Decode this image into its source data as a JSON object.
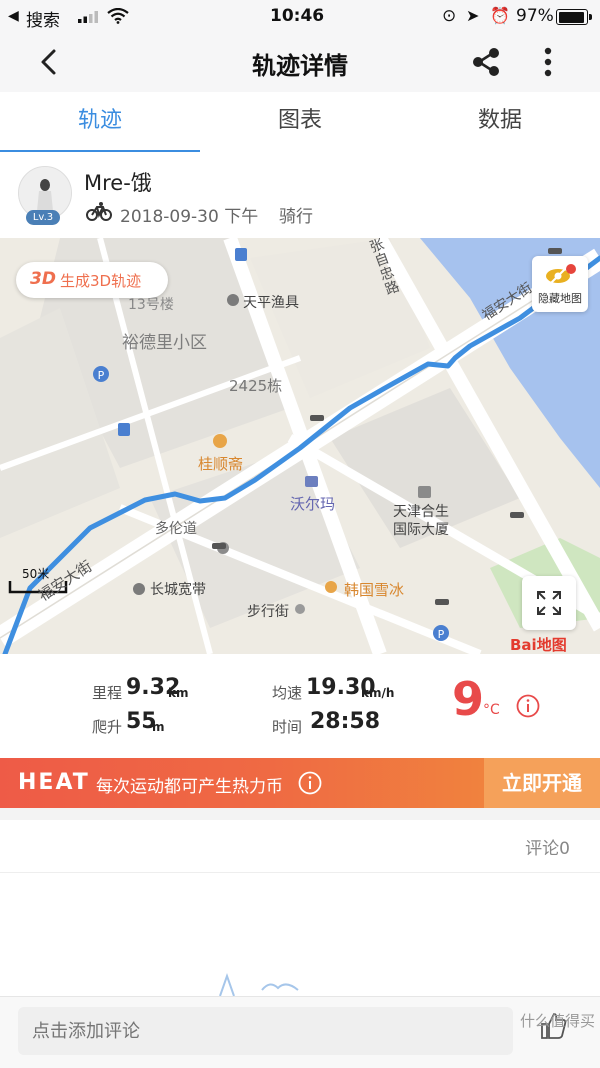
{
  "status_bar": {
    "back_app": "搜索",
    "time": "10:46",
    "battery": "97%"
  },
  "header": {
    "title": "轨迹详情",
    "back_icon": "chevron-left-icon",
    "share_icon": "share-icon",
    "more_icon": "more-vertical-icon"
  },
  "tabs": [
    {
      "label": "轨迹",
      "active": true
    },
    {
      "label": "图表",
      "active": false
    },
    {
      "label": "数据",
      "active": false
    }
  ],
  "profile": {
    "name": "Mre-饿",
    "level": "Lv.3",
    "date": "2018-09-30 下午",
    "activity": "骑行"
  },
  "map": {
    "btn_3d": "3D生成3D轨迹",
    "btn_3d_prefix": "3D",
    "btn_3d_label": "生成3D轨迹",
    "hide_map": "隐藏地图",
    "scale": "50米",
    "logo": "Bai地图",
    "labels": {
      "district": "裕德里小区",
      "tianping": "天平渔具",
      "bldg": "2425栋",
      "guishunzhai": "桂顺斋",
      "walmart": "沃尔玛",
      "tianjin1": "天津合生",
      "tianjin2": "国际大厦",
      "duolun": "多伦道",
      "changcheng": "长城宽带",
      "buxingjie": "步行街",
      "hanguo": "韩国雪冰",
      "fuan1": "福安大街",
      "fuan2": "福安大街",
      "zhangzizhong": "张自忠路",
      "building13": "13号楼"
    }
  },
  "stats": {
    "distance_label": "里程",
    "distance_value": "9.32",
    "distance_unit": "km",
    "speed_label": "均速",
    "speed_value": "19.30",
    "speed_unit": "km/h",
    "climb_label": "爬升",
    "climb_value": "55",
    "climb_unit": "m",
    "time_label": "时间",
    "time_value": "28:58",
    "temperature": "9",
    "temperature_unit": "°C"
  },
  "heat_banner": {
    "logo": "HEAT",
    "slogan": "每次运动都可产生热力币",
    "cta": "立即开通",
    "colors": {
      "start": "#ee5b47",
      "end": "#f08f3b"
    }
  },
  "comments": {
    "count_label": "评论0",
    "input_placeholder": "点击添加评论"
  },
  "watermark": "什么值得买",
  "colors": {
    "accent": "#3b8de0",
    "route": "#3f8fe0",
    "temperature": "#e84a4a"
  }
}
